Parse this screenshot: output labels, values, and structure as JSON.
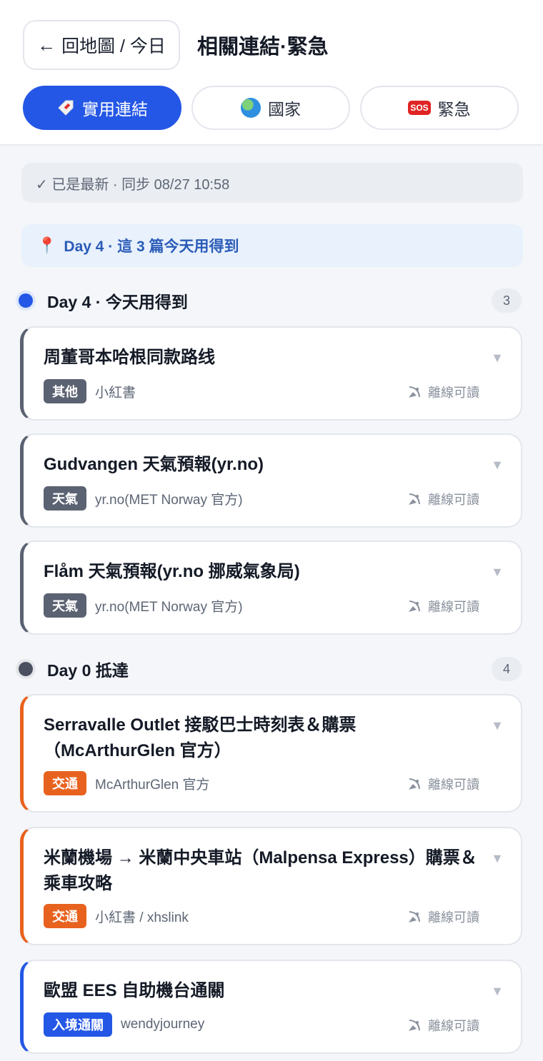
{
  "header": {
    "back_label": "回地圖 / 今日",
    "title": "相關連結·緊急",
    "tabs": [
      {
        "label": "實用連結",
        "icon": "tag-icon"
      },
      {
        "label": "國家",
        "icon": "globe-icon"
      },
      {
        "label": "緊急",
        "icon": "sos-icon",
        "icon_text": "SOS"
      }
    ]
  },
  "sync": {
    "text": "✓ 已是最新 · 同步 08/27 10:58"
  },
  "banner": {
    "text": "Day 4 · 這 3 篇今天用得到"
  },
  "offline_label": "離線可讀",
  "groups": [
    {
      "title": "Day 4 · 今天用得到",
      "count": "3",
      "items": [
        {
          "title": "周董哥本哈根同款路线",
          "tag": "其他",
          "source": "小紅書"
        },
        {
          "title": "Gudvangen 天氣預報(yr.no)",
          "tag": "天氣",
          "source": "yr.no(MET Norway 官方)"
        },
        {
          "title": "Flåm 天氣預報(yr.no 挪威氣象局)",
          "tag": "天氣",
          "source": "yr.no(MET Norway 官方)"
        }
      ]
    },
    {
      "title": "Day 0 抵達",
      "count": "4",
      "items": [
        {
          "title": "Serravalle Outlet 接駁巴士時刻表＆購票（McArthurGlen 官方）",
          "tag": "交通",
          "source": "McArthurGlen 官方"
        },
        {
          "title": "米蘭機場 → 米蘭中央車站（Malpensa Express）購票＆乘車攻略",
          "tag": "交通",
          "source": "小紅書 / xhslink"
        },
        {
          "title": "歐盟 EES 自助機台通關",
          "tag": "入境通關",
          "source": "wendyjourney"
        }
      ]
    }
  ],
  "colors": {
    "accent": "#2457e6",
    "tag_gray": "#5b6272",
    "tag_orange": "#e8621f"
  }
}
